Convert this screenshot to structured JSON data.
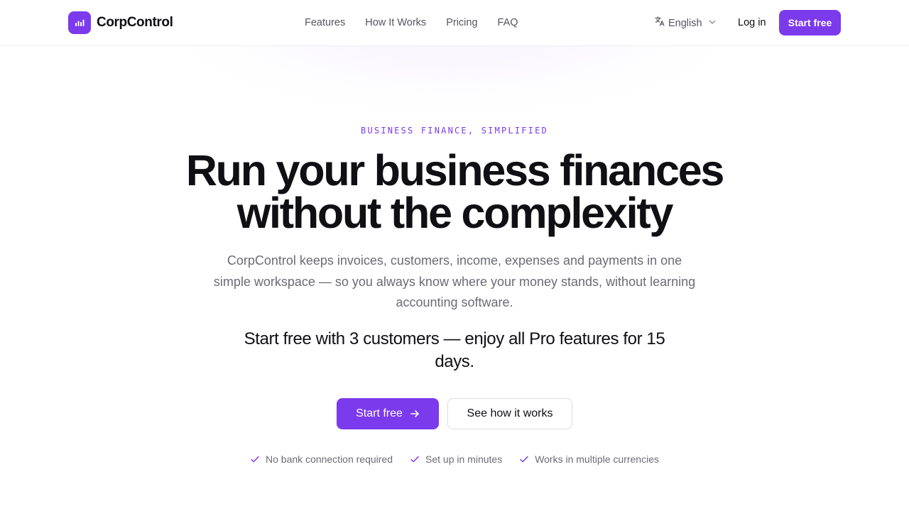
{
  "brand": {
    "name": "CorpControl",
    "logo_icon": "bar-chart-icon",
    "accent": "#7c3aed"
  },
  "nav": {
    "items": [
      {
        "label": "Features"
      },
      {
        "label": "How It Works"
      },
      {
        "label": "Pricing"
      },
      {
        "label": "FAQ"
      }
    ]
  },
  "header": {
    "language": {
      "icon": "translate-icon",
      "label": "English",
      "chevron": "chevron-down-icon"
    },
    "login_label": "Log in",
    "start_label": "Start free"
  },
  "hero": {
    "eyebrow": "BUSINESS FINANCE, SIMPLIFIED",
    "headline_line1": "Run your business finances",
    "headline_line2": "without the complexity",
    "subtext": "CorpControl keeps invoices, customers, income, expenses and payments in one simple workspace — so you always know where your money stands, without learning accounting software.",
    "offer": "Start free with 3 customers — enjoy all Pro features for 15 days.",
    "primary_cta": "Start free",
    "primary_cta_icon": "arrow-right-icon",
    "secondary_cta": "See how it works",
    "badges": [
      {
        "label": "No bank connection required",
        "icon": "check-icon"
      },
      {
        "label": "Set up in minutes",
        "icon": "check-icon"
      },
      {
        "label": "Works in multiple currencies",
        "icon": "check-icon"
      }
    ]
  }
}
